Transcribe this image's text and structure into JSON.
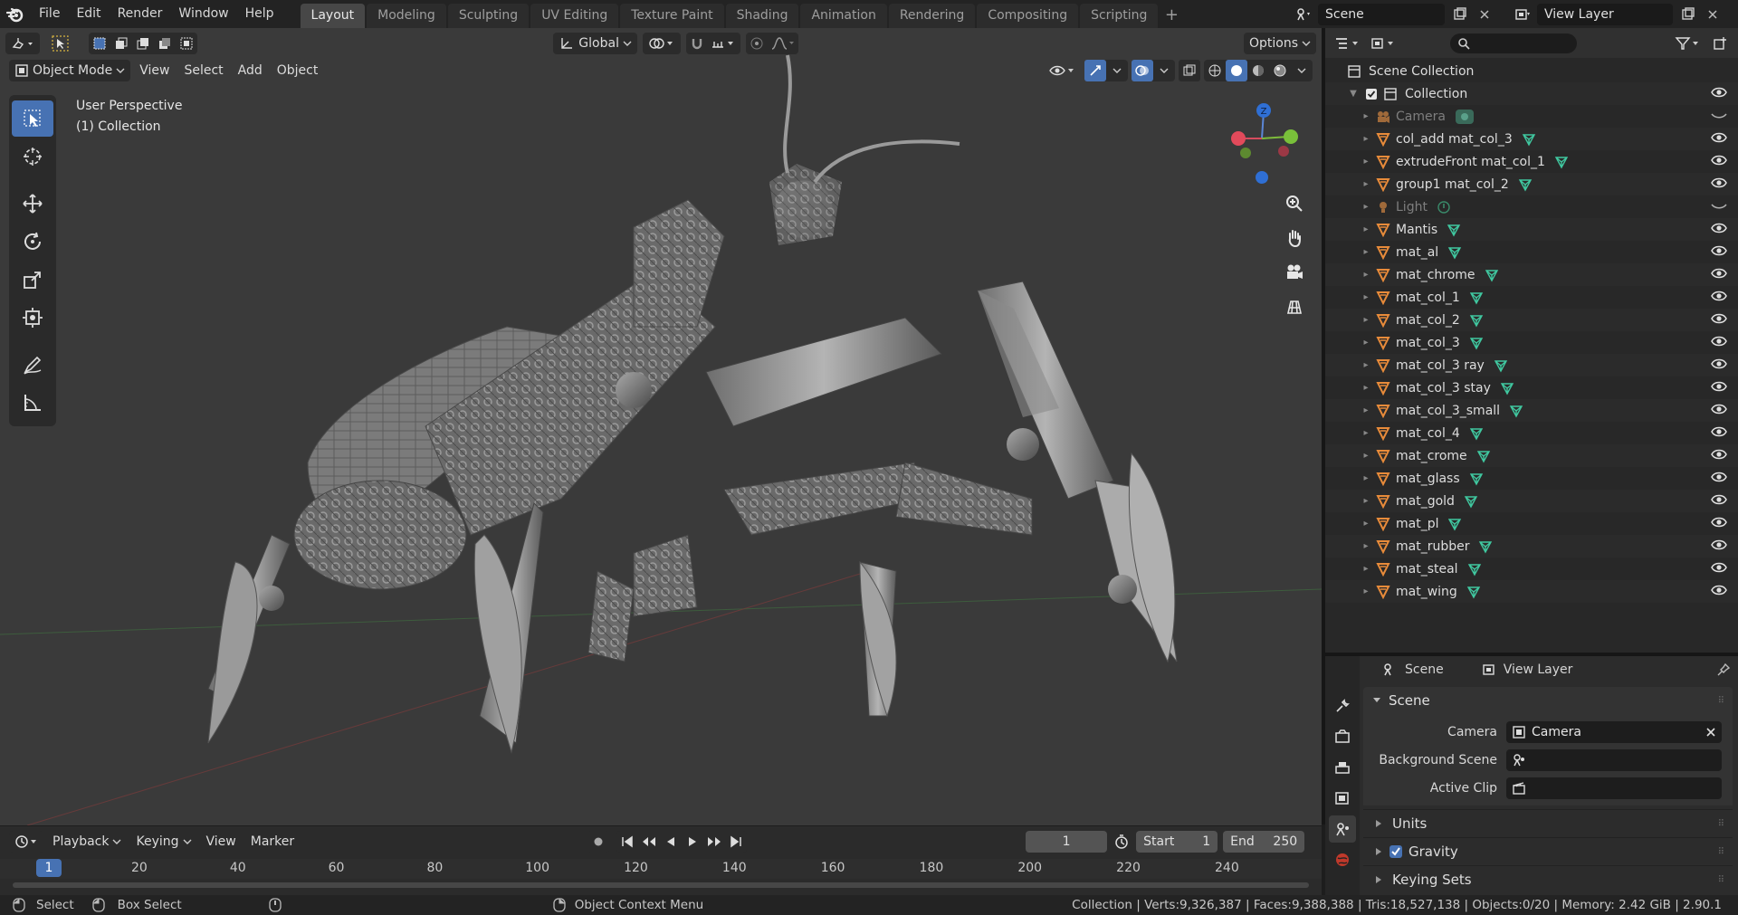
{
  "app": {
    "name": "Blender",
    "version": "2.90.1"
  },
  "menu": [
    "File",
    "Edit",
    "Render",
    "Window",
    "Help"
  ],
  "workspaces": [
    {
      "label": "Layout",
      "active": true
    },
    {
      "label": "Modeling"
    },
    {
      "label": "Sculpting"
    },
    {
      "label": "UV Editing"
    },
    {
      "label": "Texture Paint"
    },
    {
      "label": "Shading"
    },
    {
      "label": "Animation"
    },
    {
      "label": "Rendering"
    },
    {
      "label": "Compositing"
    },
    {
      "label": "Scripting"
    }
  ],
  "topbar": {
    "scene": "Scene",
    "view_layer": "View Layer"
  },
  "viewport": {
    "transform_orientation": "Global",
    "options_label": "Options",
    "mode": "Object Mode",
    "menus": [
      "View",
      "Select",
      "Add",
      "Object"
    ],
    "info_line1": "User Perspective",
    "info_line2": "(1) Collection",
    "gizmo": {
      "z": "Z",
      "y": "Y",
      "x": "X"
    }
  },
  "outliner": {
    "root": "Scene Collection",
    "collection": "Collection",
    "items": [
      {
        "name": "Camera",
        "type": "camera",
        "dim": true
      },
      {
        "name": "col_add mat_col_3",
        "type": "mesh"
      },
      {
        "name": "extrudeFront mat_col_1",
        "type": "mesh"
      },
      {
        "name": "group1 mat_col_2",
        "type": "mesh"
      },
      {
        "name": "Light",
        "type": "light",
        "dim": true
      },
      {
        "name": "Mantis",
        "type": "mesh"
      },
      {
        "name": "mat_al",
        "type": "mesh"
      },
      {
        "name": "mat_chrome",
        "type": "mesh"
      },
      {
        "name": "mat_col_1",
        "type": "mesh"
      },
      {
        "name": "mat_col_2",
        "type": "mesh"
      },
      {
        "name": "mat_col_3",
        "type": "mesh"
      },
      {
        "name": "mat_col_3 ray",
        "type": "mesh"
      },
      {
        "name": "mat_col_3 stay",
        "type": "mesh"
      },
      {
        "name": "mat_col_3_small",
        "type": "mesh"
      },
      {
        "name": "mat_col_4",
        "type": "mesh"
      },
      {
        "name": "mat_crome",
        "type": "mesh"
      },
      {
        "name": "mat_glass",
        "type": "mesh"
      },
      {
        "name": "mat_gold",
        "type": "mesh"
      },
      {
        "name": "mat_pl",
        "type": "mesh"
      },
      {
        "name": "mat_rubber",
        "type": "mesh"
      },
      {
        "name": "mat_steal",
        "type": "mesh"
      },
      {
        "name": "mat_wing",
        "type": "mesh"
      }
    ]
  },
  "properties": {
    "tab_scene": "Scene",
    "tab_view_layer": "View Layer",
    "panel_title": "Scene",
    "camera_label": "Camera",
    "camera_value": "Camera",
    "background_scene_label": "Background Scene",
    "active_clip_label": "Active Clip",
    "units_label": "Units",
    "gravity_label": "Gravity",
    "gravity_enabled": true,
    "keying_sets_label": "Keying Sets"
  },
  "timeline": {
    "menus": [
      "Playback",
      "Keying",
      "View",
      "Marker"
    ],
    "current_frame": "1",
    "start_label": "Start",
    "start_value": "1",
    "end_label": "End",
    "end_value": "250",
    "ruler_current": "1",
    "ruler_ticks": [
      "20",
      "40",
      "60",
      "80",
      "100",
      "120",
      "140",
      "160",
      "180",
      "200",
      "220",
      "240"
    ]
  },
  "statusbar": {
    "select": "Select",
    "box_select": "Box Select",
    "context_menu": "Object Context Menu",
    "stats": "Collection | Verts:9,326,387 | Faces:9,388,388 | Tris:18,527,138 | Objects:0/20 | Memory: 2.42 GiB | 2.90.1"
  },
  "colors": {
    "accent": "#4772b3",
    "mesh_icon": "#e88b3a",
    "data_icon": "#40c8a0",
    "viewport_bg": "#3a3a3a"
  }
}
